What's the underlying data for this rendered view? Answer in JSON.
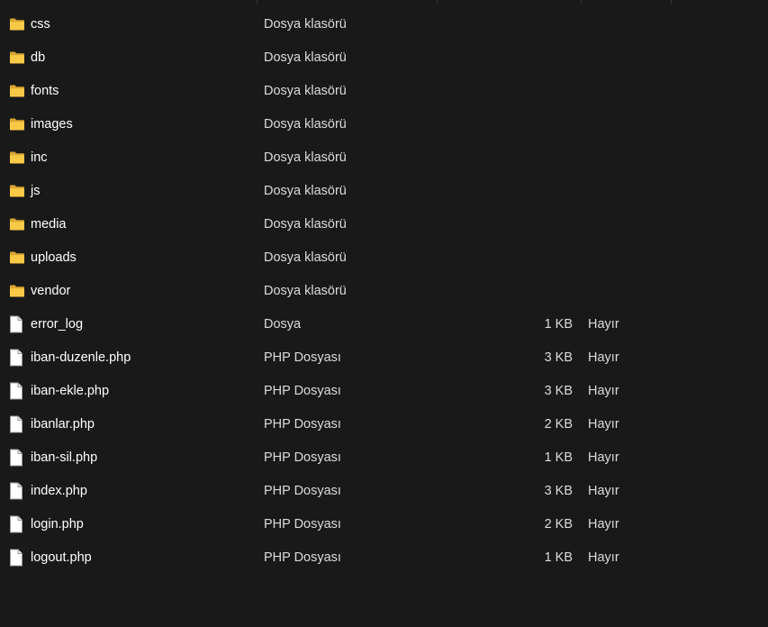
{
  "colors": {
    "background": "#191919",
    "folder": "#f8c947",
    "file_page": "#ffffff"
  },
  "rows": [
    {
      "name": "css",
      "type": "Dosya klasörü",
      "size": "",
      "extra": "",
      "icon": "folder-icon"
    },
    {
      "name": "db",
      "type": "Dosya klasörü",
      "size": "",
      "extra": "",
      "icon": "folder-icon"
    },
    {
      "name": "fonts",
      "type": "Dosya klasörü",
      "size": "",
      "extra": "",
      "icon": "folder-icon"
    },
    {
      "name": "images",
      "type": "Dosya klasörü",
      "size": "",
      "extra": "",
      "icon": "folder-icon"
    },
    {
      "name": "inc",
      "type": "Dosya klasörü",
      "size": "",
      "extra": "",
      "icon": "folder-icon"
    },
    {
      "name": "js",
      "type": "Dosya klasörü",
      "size": "",
      "extra": "",
      "icon": "folder-icon"
    },
    {
      "name": "media",
      "type": "Dosya klasörü",
      "size": "",
      "extra": "",
      "icon": "folder-icon"
    },
    {
      "name": "uploads",
      "type": "Dosya klasörü",
      "size": "",
      "extra": "",
      "icon": "folder-icon"
    },
    {
      "name": "vendor",
      "type": "Dosya klasörü",
      "size": "",
      "extra": "",
      "icon": "folder-icon"
    },
    {
      "name": "error_log",
      "type": "Dosya",
      "size": "1 KB",
      "extra": "Hayır",
      "icon": "file-icon"
    },
    {
      "name": "iban-duzenle.php",
      "type": "PHP Dosyası",
      "size": "3 KB",
      "extra": "Hayır",
      "icon": "file-icon"
    },
    {
      "name": "iban-ekle.php",
      "type": "PHP Dosyası",
      "size": "3 KB",
      "extra": "Hayır",
      "icon": "file-icon"
    },
    {
      "name": "ibanlar.php",
      "type": "PHP Dosyası",
      "size": "2 KB",
      "extra": "Hayır",
      "icon": "file-icon"
    },
    {
      "name": "iban-sil.php",
      "type": "PHP Dosyası",
      "size": "1 KB",
      "extra": "Hayır",
      "icon": "file-icon"
    },
    {
      "name": "index.php",
      "type": "PHP Dosyası",
      "size": "3 KB",
      "extra": "Hayır",
      "icon": "file-icon"
    },
    {
      "name": "login.php",
      "type": "PHP Dosyası",
      "size": "2 KB",
      "extra": "Hayır",
      "icon": "file-icon"
    },
    {
      "name": "logout.php",
      "type": "PHP Dosyası",
      "size": "1 KB",
      "extra": "Hayır",
      "icon": "file-icon"
    }
  ]
}
